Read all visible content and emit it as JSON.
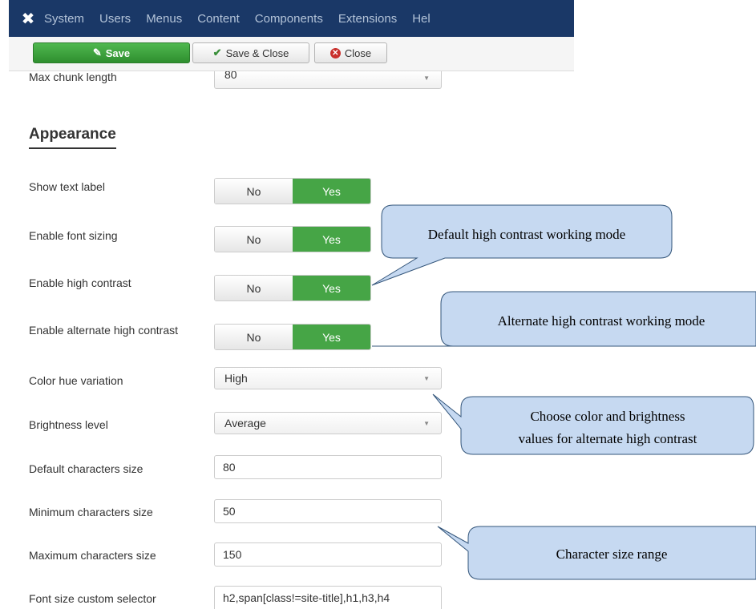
{
  "navbar": {
    "logo_icon": "joomla-logo",
    "menu": [
      "System",
      "Users",
      "Menus",
      "Content",
      "Components",
      "Extensions",
      "Help"
    ]
  },
  "toolbar": {
    "save_label": "Save",
    "save_close_label": "Save & Close",
    "close_label": "Close"
  },
  "fields": {
    "max_chunk_length": {
      "label": "Max chunk length",
      "value": "80"
    },
    "section_title": "Appearance",
    "show_text_label": {
      "label": "Show text label",
      "no": "No",
      "yes": "Yes"
    },
    "enable_font_sizing": {
      "label": "Enable font sizing",
      "no": "No",
      "yes": "Yes"
    },
    "enable_high_contrast": {
      "label": "Enable high contrast",
      "no": "No",
      "yes": "Yes"
    },
    "enable_alt_high_contrast": {
      "label": "Enable alternate high contrast",
      "no": "No",
      "yes": "Yes"
    },
    "color_hue_variation": {
      "label": "Color hue variation",
      "value": "High"
    },
    "brightness_level": {
      "label": "Brightness level",
      "value": "Average"
    },
    "default_char_size": {
      "label": "Default characters size",
      "value": "80"
    },
    "min_char_size": {
      "label": "Minimum characters size",
      "value": "50"
    },
    "max_char_size": {
      "label": "Maximum characters size",
      "value": "150"
    },
    "font_size_selector": {
      "label": "Font size custom selector",
      "value": "h2,span[class!=site-title],h1,h3,h4"
    }
  },
  "callouts": {
    "default_hc": "Default high contrast working mode",
    "alternate_hc": "Alternate high contrast working mode",
    "color_brightness_1": "Choose color and brightness",
    "color_brightness_2": "values for alternate high contrast",
    "char_size_range": "Character size range"
  },
  "colors": {
    "navbar_bg": "#1a3867",
    "save_green": "#46a546",
    "toggle_yes": "#46a546",
    "callout_fill": "#c6d9f1"
  }
}
